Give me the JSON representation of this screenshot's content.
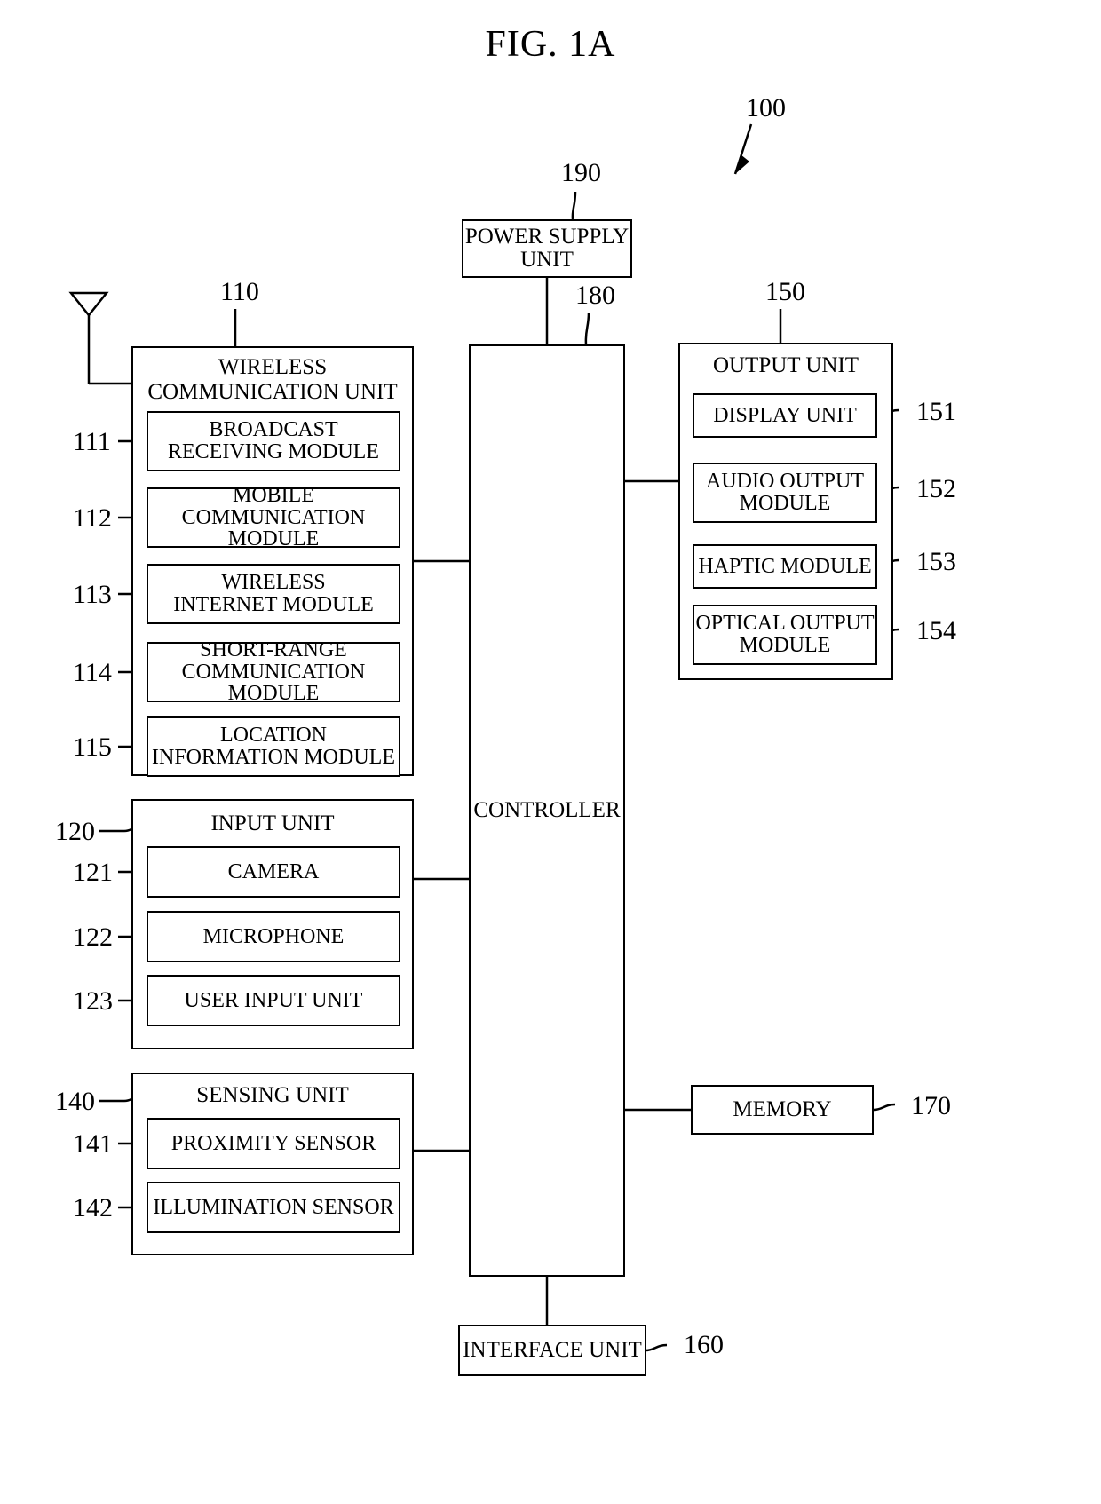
{
  "figure": {
    "title": "FIG. 1A",
    "system_ref": "100"
  },
  "power_supply": {
    "label": "POWER SUPPLY\nUNIT",
    "line1": "POWER SUPPLY",
    "line2": "UNIT",
    "ref": "190"
  },
  "controller": {
    "label": "CONTROLLER",
    "ref": "180"
  },
  "memory": {
    "label": "MEMORY",
    "ref": "170"
  },
  "interface": {
    "label": "INTERFACE UNIT",
    "ref": "160"
  },
  "antenna": {
    "name": "antenna-symbol"
  },
  "wireless_communication_unit": {
    "header_line1": "WIRELESS",
    "header_line2": "COMMUNICATION UNIT",
    "ref": "110",
    "modules": [
      {
        "ref": "111",
        "line1": "BROADCAST",
        "line2": "RECEIVING MODULE"
      },
      {
        "ref": "112",
        "line1": "MOBILE",
        "line2": "COMMUNICATION MODULE"
      },
      {
        "ref": "113",
        "line1": "WIRELESS",
        "line2": "INTERNET MODULE"
      },
      {
        "ref": "114",
        "line1": "SHORT-RANGE",
        "line2": "COMMUNICATION MODULE"
      },
      {
        "ref": "115",
        "line1": "LOCATION",
        "line2": "INFORMATION MODULE"
      }
    ]
  },
  "input_unit": {
    "header": "INPUT UNIT",
    "ref": "120",
    "modules": [
      {
        "ref": "121",
        "line1": "CAMERA",
        "line2": ""
      },
      {
        "ref": "122",
        "line1": "MICROPHONE",
        "line2": ""
      },
      {
        "ref": "123",
        "line1": "USER INPUT UNIT",
        "line2": ""
      }
    ]
  },
  "sensing_unit": {
    "header": "SENSING UNIT",
    "ref": "140",
    "modules": [
      {
        "ref": "141",
        "line1": "PROXIMITY SENSOR",
        "line2": ""
      },
      {
        "ref": "142",
        "line1": "ILLUMINATION SENSOR",
        "line2": ""
      }
    ]
  },
  "output_unit": {
    "header": "OUTPUT UNIT",
    "ref": "150",
    "modules": [
      {
        "ref": "151",
        "line1": "DISPLAY UNIT",
        "line2": ""
      },
      {
        "ref": "152",
        "line1": "AUDIO OUTPUT",
        "line2": "MODULE"
      },
      {
        "ref": "153",
        "line1": "HAPTIC MODULE",
        "line2": ""
      },
      {
        "ref": "154",
        "line1": "OPTICAL OUTPUT",
        "line2": "MODULE"
      }
    ]
  }
}
